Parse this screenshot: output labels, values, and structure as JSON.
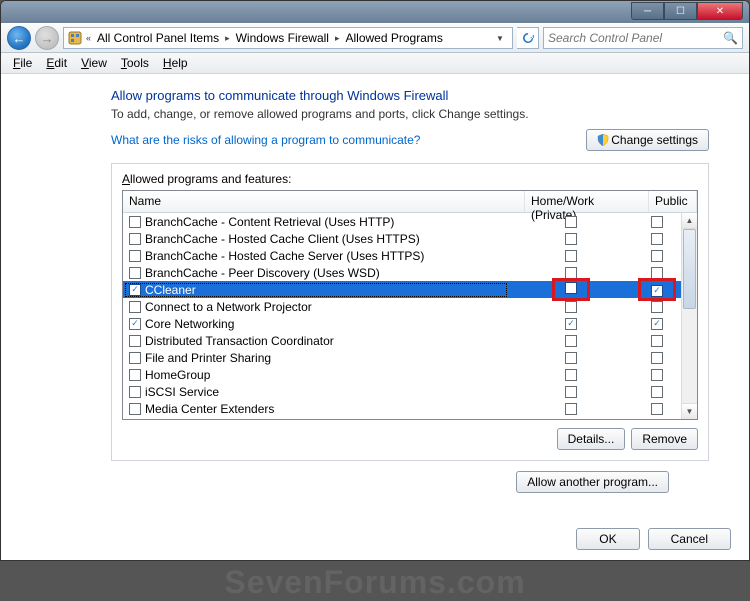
{
  "breadcrumb": {
    "a": "All Control Panel Items",
    "b": "Windows Firewall",
    "c": "Allowed Programs"
  },
  "search": {
    "placeholder": "Search Control Panel"
  },
  "menu": {
    "file": "File",
    "edit": "Edit",
    "view": "View",
    "tools": "Tools",
    "help": "Help"
  },
  "heading": "Allow programs to communicate through Windows Firewall",
  "subheading": "To add, change, or remove allowed programs and ports, click Change settings.",
  "risk_link": "What are the risks of allowing a program to communicate?",
  "change_settings": "Change settings",
  "list_label": "Allowed programs and features:",
  "columns": {
    "name": "Name",
    "hw": "Home/Work (Private)",
    "pub": "Public"
  },
  "rows": [
    {
      "name": "BranchCache - Content Retrieval (Uses HTTP)",
      "en": false,
      "hw": false,
      "pub": false,
      "sel": false
    },
    {
      "name": "BranchCache - Hosted Cache Client (Uses HTTPS)",
      "en": false,
      "hw": false,
      "pub": false,
      "sel": false
    },
    {
      "name": "BranchCache - Hosted Cache Server (Uses HTTPS)",
      "en": false,
      "hw": false,
      "pub": false,
      "sel": false
    },
    {
      "name": "BranchCache - Peer Discovery (Uses WSD)",
      "en": false,
      "hw": false,
      "pub": false,
      "sel": false
    },
    {
      "name": "CCleaner",
      "en": true,
      "hw": false,
      "pub": true,
      "sel": true
    },
    {
      "name": "Connect to a Network Projector",
      "en": false,
      "hw": false,
      "pub": false,
      "sel": false
    },
    {
      "name": "Core Networking",
      "en": true,
      "hw": true,
      "pub": true,
      "sel": false
    },
    {
      "name": "Distributed Transaction Coordinator",
      "en": false,
      "hw": false,
      "pub": false,
      "sel": false
    },
    {
      "name": "File and Printer Sharing",
      "en": false,
      "hw": false,
      "pub": false,
      "sel": false
    },
    {
      "name": "HomeGroup",
      "en": false,
      "hw": false,
      "pub": false,
      "sel": false
    },
    {
      "name": "iSCSI Service",
      "en": false,
      "hw": false,
      "pub": false,
      "sel": false
    },
    {
      "name": "Media Center Extenders",
      "en": false,
      "hw": false,
      "pub": false,
      "sel": false
    }
  ],
  "details": "Details...",
  "remove": "Remove",
  "allow_another": "Allow another program...",
  "ok": "OK",
  "cancel": "Cancel",
  "watermark": "SevenForums.com"
}
